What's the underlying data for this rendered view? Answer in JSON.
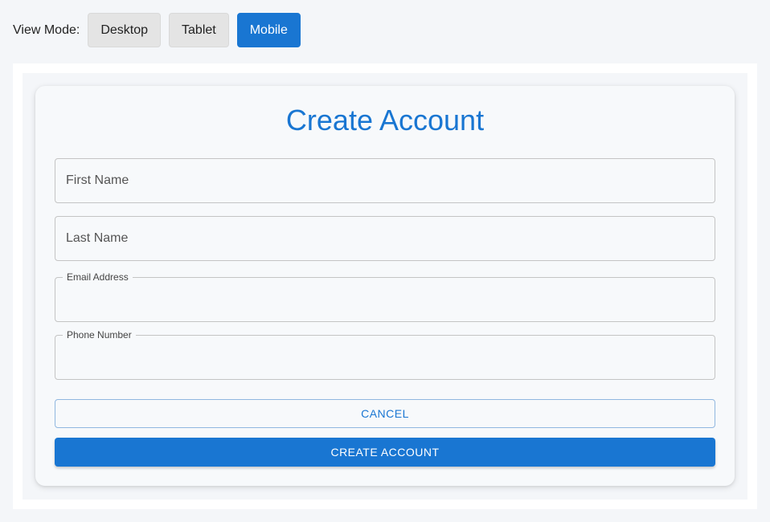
{
  "view_mode": {
    "label": "View Mode:",
    "options": [
      "Desktop",
      "Tablet",
      "Mobile"
    ],
    "selected": "Mobile"
  },
  "form": {
    "title": "Create Account",
    "fields": {
      "first_name": {
        "placeholder": "First Name",
        "value": ""
      },
      "last_name": {
        "placeholder": "Last Name",
        "value": ""
      },
      "email": {
        "label": "Email Address",
        "value": ""
      },
      "phone": {
        "label": "Phone Number",
        "value": ""
      }
    },
    "cancel_label": "CANCEL",
    "submit_label": "CREATE ACCOUNT"
  },
  "colors": {
    "accent": "#1976d2",
    "page_bg": "#f4f6f9",
    "card_bg": "#f7f9fb"
  }
}
